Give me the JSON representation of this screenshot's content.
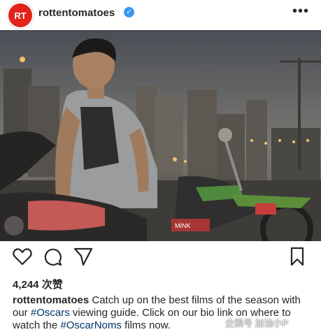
{
  "post": {
    "username": "rottentomatoes",
    "avatar_text": "RT",
    "likes": "4,244 次赞",
    "caption": {
      "username": "rottentomatoes",
      "part1": " Catch up on the best films of the season with our ",
      "tag1": "#Oscars",
      "part2": " viewing guide. Click on our bio link on where to watch the ",
      "tag2": "#OscarNoms",
      "part3": " films now."
    },
    "photo_sign_text": "MINK"
  },
  "watermark": "企鹅号 加油小P",
  "colors": {
    "brand_red": "#e2231a",
    "verified_blue": "#3897f0",
    "hashtag": "#003569"
  },
  "icons": [
    "more-options-icon",
    "heart-icon",
    "comment-icon",
    "share-icon",
    "bookmark-icon",
    "verified-badge-icon"
  ]
}
